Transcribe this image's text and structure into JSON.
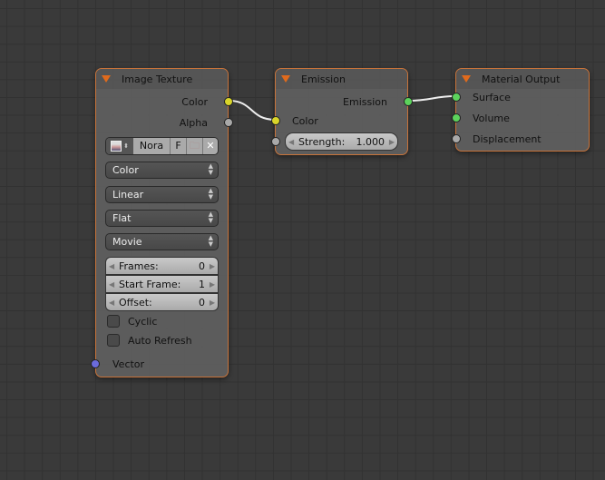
{
  "image_texture": {
    "title": "Image Texture",
    "outputs": [
      "Color",
      "Alpha"
    ],
    "image_name": "Nora",
    "fake_user": "F",
    "color_space": "Color",
    "interpolation": "Linear",
    "projection": "Flat",
    "source": "Movie",
    "frames_label": "Frames:",
    "frames": "0",
    "start_label": "Start Frame:",
    "start": "1",
    "offset_label": "Offset:",
    "offset": "0",
    "cyclic": "Cyclic",
    "auto_refresh": "Auto Refresh",
    "input": "Vector"
  },
  "emission": {
    "title": "Emission",
    "output": "Emission",
    "color": "Color",
    "strength_label": "Strength:",
    "strength": "1.000"
  },
  "material_output": {
    "title": "Material Output",
    "inputs": [
      "Surface",
      "Volume",
      "Displacement"
    ]
  },
  "colors": {
    "accent": "#c8733a",
    "color_socket": "#d9d52a",
    "shader_socket": "#5cd25c",
    "vector_socket": "#6b6bdc"
  }
}
